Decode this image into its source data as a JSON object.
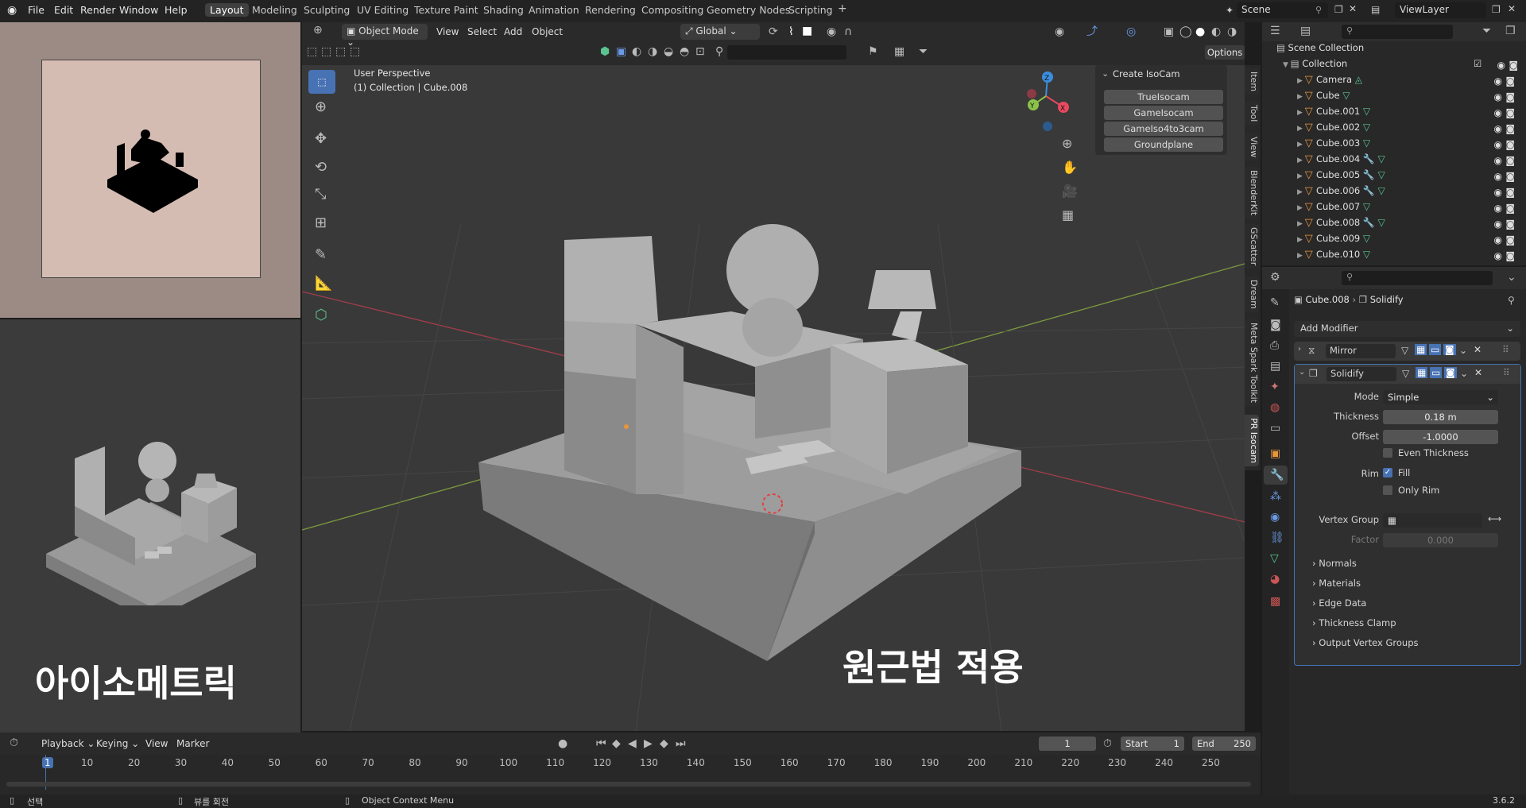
{
  "menu": {
    "file": "File",
    "edit": "Edit",
    "render": "Render",
    "window": "Window",
    "help": "Help"
  },
  "workspaces": [
    "Layout",
    "Modeling",
    "Sculpting",
    "UV Editing",
    "Texture Paint",
    "Shading",
    "Animation",
    "Rendering",
    "Compositing",
    "Geometry Nodes",
    "Scripting"
  ],
  "workspace_add": "+",
  "scene": {
    "label": "Scene",
    "viewlayer": "ViewLayer"
  },
  "viewport": {
    "mode": "Object Mode",
    "menus": [
      "View",
      "Select",
      "Add",
      "Object"
    ],
    "orientation": "Global",
    "options": "Options",
    "info_line1": "User Perspective",
    "info_line2": "(1) Collection | Cube.008",
    "overlay_text_left": "아이소메트릭",
    "overlay_text_right": "원근법 적용"
  },
  "isocam": {
    "title": "Create IsoCam",
    "buttons": [
      "TrueIsocam",
      "GameIsocam",
      "GameIso4to3cam",
      "Groundplane"
    ]
  },
  "side_tabs": [
    "Item",
    "Tool",
    "View",
    "BlenderKit",
    "GScatter",
    "Dream",
    "Meta Spark Toolkit",
    "PR Isocam"
  ],
  "outliner": {
    "root": "Scene Collection",
    "collection": "Collection",
    "items": [
      "Camera",
      "Cube",
      "Cube.001",
      "Cube.002",
      "Cube.003",
      "Cube.004",
      "Cube.005",
      "Cube.006",
      "Cube.007",
      "Cube.008",
      "Cube.009",
      "Cube.010"
    ]
  },
  "properties": {
    "object": "Cube.008",
    "modifier": "Solidify",
    "add_modifier": "Add Modifier",
    "mod1": "Mirror",
    "mod2": "Solidify",
    "mode_label": "Mode",
    "mode_value": "Simple",
    "thickness_label": "Thickness",
    "thickness_value": "0.18 m",
    "offset_label": "Offset",
    "offset_value": "-1.0000",
    "even_thickness": "Even Thickness",
    "rim_label": "Rim",
    "fill": "Fill",
    "only_rim": "Only Rim",
    "vgroup_label": "Vertex Group",
    "factor_label": "Factor",
    "factor_value": "0.000",
    "subpanels": [
      "Normals",
      "Materials",
      "Edge Data",
      "Thickness Clamp",
      "Output Vertex Groups"
    ]
  },
  "timeline": {
    "menus": [
      "Playback",
      "Keying",
      "View",
      "Marker"
    ],
    "current_frame": "1",
    "start_label": "Start",
    "start": "1",
    "end_label": "End",
    "end": "250",
    "ticks": [
      "1",
      "10",
      "20",
      "30",
      "40",
      "50",
      "60",
      "70",
      "80",
      "90",
      "100",
      "110",
      "120",
      "130",
      "140",
      "150",
      "160",
      "170",
      "180",
      "190",
      "200",
      "210",
      "220",
      "230",
      "240",
      "250"
    ]
  },
  "status": {
    "select": "선택",
    "rotate": "뷰를 회전",
    "context": "Object Context Menu",
    "version": "3.6.2"
  },
  "colors": {
    "accent": "#4772b3",
    "object_orange": "#e8963c",
    "mesh_green": "#5bc38f",
    "x_axis": "#e84a5f",
    "y_axis": "#8bc34a",
    "z_axis": "#3b8ede"
  }
}
